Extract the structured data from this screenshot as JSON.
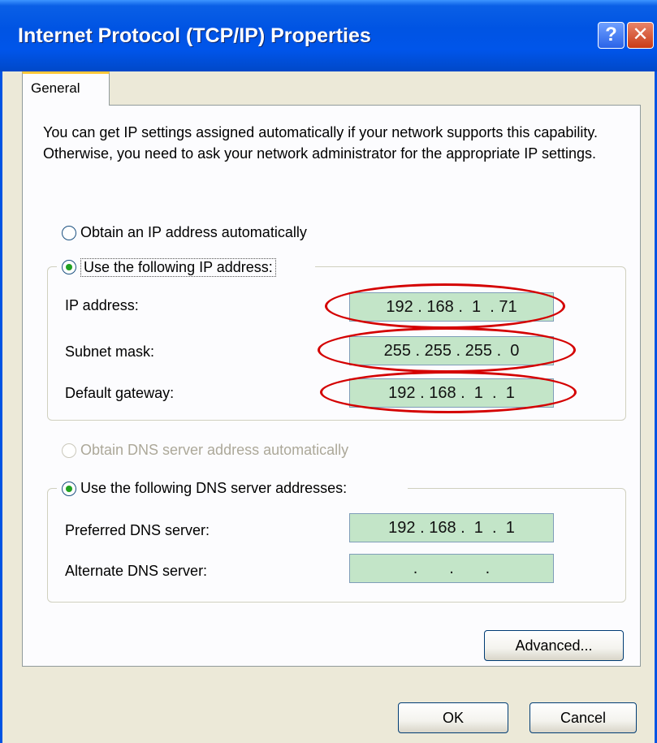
{
  "window": {
    "title": "Internet Protocol (TCP/IP) Properties",
    "help_label": "?",
    "close_label": "✕"
  },
  "tabs": [
    {
      "label": "General",
      "selected": true
    }
  ],
  "description": "You can get IP settings assigned automatically if your network supports this capability. Otherwise, you need to ask your network administrator for the appropriate IP settings.",
  "ip_section": {
    "auto_option": {
      "label": "Obtain an IP address automatically",
      "checked": false
    },
    "manual_option": {
      "label": "Use the following IP address:",
      "checked": true
    },
    "fields": [
      {
        "label": "IP address:",
        "value": "192 . 168 .  1  . 71",
        "highlighted": true
      },
      {
        "label": "Subnet mask:",
        "value": "255 . 255 . 255 .  0",
        "highlighted": true
      },
      {
        "label": "Default gateway:",
        "value": "192 . 168 .  1  .  1",
        "highlighted": true
      }
    ]
  },
  "dns_section": {
    "auto_option": {
      "label": "Obtain DNS server address automatically",
      "checked": false,
      "enabled": false
    },
    "manual_option": {
      "label": "Use the following DNS server addresses:",
      "checked": true
    },
    "fields": [
      {
        "label": "Preferred DNS server:",
        "value": "192 . 168 .  1  .  1"
      },
      {
        "label": "Alternate DNS server:",
        "value": "  .       .       .  "
      }
    ]
  },
  "buttons": {
    "advanced": "Advanced...",
    "ok": "OK",
    "cancel": "Cancel"
  },
  "colors": {
    "title_bar": "#0054E3",
    "dialog_bg": "#ECE9D8",
    "field_bg": "#C3E5C8",
    "highlight_ellipse": "#D40000",
    "radio_dot": "#21A121"
  }
}
